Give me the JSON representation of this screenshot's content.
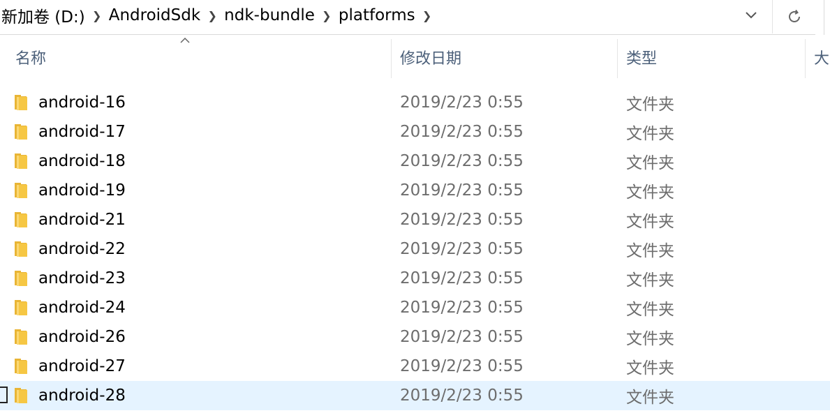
{
  "breadcrumb": [
    "新加卷 (D:)",
    "AndroidSdk",
    "ndk-bundle",
    "platforms"
  ],
  "columns": {
    "name": "名称",
    "date": "修改日期",
    "type": "类型",
    "size": "大"
  },
  "files": [
    {
      "name": "android-16",
      "date": "2019/2/23 0:55",
      "type": "文件夹"
    },
    {
      "name": "android-17",
      "date": "2019/2/23 0:55",
      "type": "文件夹"
    },
    {
      "name": "android-18",
      "date": "2019/2/23 0:55",
      "type": "文件夹"
    },
    {
      "name": "android-19",
      "date": "2019/2/23 0:55",
      "type": "文件夹"
    },
    {
      "name": "android-21",
      "date": "2019/2/23 0:55",
      "type": "文件夹"
    },
    {
      "name": "android-22",
      "date": "2019/2/23 0:55",
      "type": "文件夹"
    },
    {
      "name": "android-23",
      "date": "2019/2/23 0:55",
      "type": "文件夹"
    },
    {
      "name": "android-24",
      "date": "2019/2/23 0:55",
      "type": "文件夹"
    },
    {
      "name": "android-26",
      "date": "2019/2/23 0:55",
      "type": "文件夹"
    },
    {
      "name": "android-27",
      "date": "2019/2/23 0:55",
      "type": "文件夹"
    },
    {
      "name": "android-28",
      "date": "2019/2/23 0:55",
      "type": "文件夹",
      "selected": true
    }
  ],
  "icons": {
    "separator": "chevron-right-icon",
    "dropdown": "chevron-down-icon",
    "refresh": "refresh-icon",
    "folder": "folder-icon",
    "sort": "sort-up-icon"
  },
  "colors": {
    "header_text": "#4c607a",
    "selected_row": "#e5f3ff",
    "folder_yellow": "#f6c744",
    "muted_text": "#6d6d6d"
  }
}
